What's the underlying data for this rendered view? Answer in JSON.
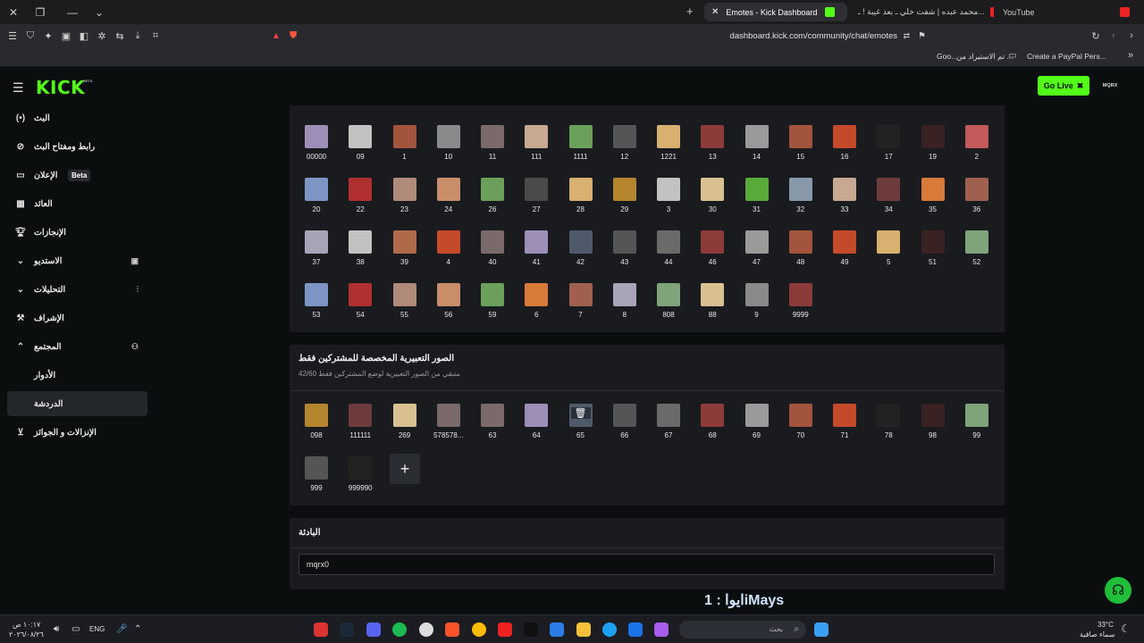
{
  "browser": {
    "tabs": [
      {
        "label": "Emotes - Kick Dashboard",
        "active": true
      },
      {
        "label": "محمد عبده | شفت خلي ـ بعد غيبة ! ـ...",
        "active": false
      },
      {
        "label": "YouTube",
        "active": false
      }
    ],
    "url": "dashboard.kick.com/community/chat/emotes",
    "bookmarks": [
      "Create a PayPal Pers...",
      "تم الاستيراد من ...",
      "Goo..."
    ]
  },
  "header": {
    "logo": "KICK",
    "logo_badge": "BETA",
    "go_live": "Go Live",
    "username": "MQRX"
  },
  "sidebar": {
    "items": [
      {
        "label": "البث",
        "icon": "broadcast-icon"
      },
      {
        "label": "رابط ومفتاح البث",
        "icon": "link-icon"
      },
      {
        "label": "الإعلان",
        "badge": "Beta",
        "icon": "ad-icon"
      },
      {
        "label": "العائد",
        "icon": "revenue-icon"
      },
      {
        "label": "الإنجازات",
        "icon": "trophy-icon"
      },
      {
        "label": "الاستديو",
        "icon": "studio-icon"
      },
      {
        "label": "التحليلات",
        "icon": "analytics-icon"
      },
      {
        "label": "الإشراف",
        "icon": "moderation-icon"
      },
      {
        "label": "المجتمع",
        "icon": "community-icon"
      },
      {
        "label": "الأدوار",
        "icon": ""
      },
      {
        "label": "الدردشة",
        "icon": ""
      },
      {
        "label": "الإنزالات و الجوائز",
        "icon": "drops-icon"
      }
    ]
  },
  "emotes_main": {
    "emotes": [
      "00000",
      "09",
      "1",
      "10",
      "11",
      "111",
      "1111",
      "12",
      "1221",
      "13",
      "14",
      "15",
      "16",
      "17",
      "19",
      "2",
      "20",
      "22",
      "23",
      "24",
      "26",
      "27",
      "28",
      "29",
      "3",
      "30",
      "31",
      "32",
      "33",
      "34",
      "35",
      "36",
      "37",
      "38",
      "39",
      "4",
      "40",
      "41",
      "42",
      "43",
      "44",
      "46",
      "47",
      "48",
      "49",
      "5",
      "51",
      "52",
      "53",
      "54",
      "55",
      "56",
      "59",
      "6",
      "7",
      "8",
      "808",
      "88",
      "9",
      "9999"
    ]
  },
  "subscriber_emotes": {
    "title": "الصور التعبيرية المخصصة للمشتركين فقط",
    "subtitle": "متبقي من الصور التعبيرية لوضع المشتركين فقط 42/60",
    "emotes": [
      "098",
      "111111",
      "269",
      "578578...",
      "63",
      "64",
      "65",
      "66",
      "67",
      "68",
      "69",
      "70",
      "71",
      "78",
      "98",
      "99",
      "999",
      "999990"
    ]
  },
  "banner": {
    "title": "البادئة",
    "value": "mqrx0"
  },
  "overlay": {
    "text": "ايوا : 1iMays"
  },
  "taskbar": {
    "time": "١٠:١٧ ص",
    "date": "٢٠٢٦/٠٨/٢٦",
    "lang": "ENG",
    "search_placeholder": "بحث",
    "temperature": "33°C",
    "weather": "سماء صافية"
  }
}
